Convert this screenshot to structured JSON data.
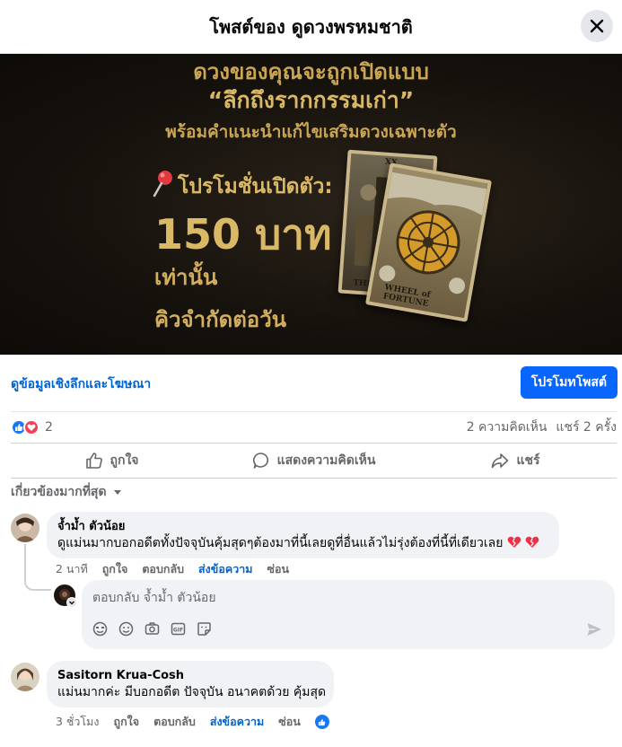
{
  "header": {
    "title": "โพสต์ของ ดูดวงพรหมชาติ"
  },
  "ad": {
    "line1": "ดวงของคุณจะถูกเปิดแบบ",
    "line2": "“ลึกถึงรากกรรมเก่า”",
    "line3": "พร้อมคำแนะนำแก้ไขเสริมดวงเฉพาะตัว",
    "line4": "โปรโมชั่นเปิดตัว:",
    "line5": "150 บาท",
    "line6": "เท่านั้น",
    "line7": "คิวจำกัดต่อวัน",
    "card_left_label": "THE",
    "card_right_label": "WHEEL of FORTUNE",
    "card_left_numeral": "XX"
  },
  "insights": {
    "link": "ดูข้อมูลเชิงลึกและโฆษณา",
    "promote_button": "โปรโมทโพสต์"
  },
  "reactions": {
    "count": "2",
    "comments": "2 ความคิดเห็น",
    "shares": "แชร์ 2 ครั้ง"
  },
  "actions": {
    "like": "ถูกใจ",
    "comment": "แสดงความคิดเห็น",
    "share": "แชร์"
  },
  "sort": {
    "label": "เกี่ยวข้องมากที่สุด"
  },
  "comments": [
    {
      "author": "จ้ำม้ำ ตัวน้อย",
      "text": "ดูแม่นมากบอกอดีตทั้งปัจจุบันคุ้มสุดๆต้องมาที่นี้เลยดูที่อื่นแล้วไม่รุ่งต้องที่นี้ที่เดียวเลย",
      "time": "2 นาที",
      "like": "ถูกใจ",
      "reply": "ตอบกลับ",
      "message": "ส่งข้อความ",
      "hide": "ซ่อน"
    },
    {
      "author": "Sasitorn Krua-Cosh",
      "text": "แม่นมากค่ะ มีบอกอดีต ปัจจุบัน อนาคตด้วย คุ้มสุด",
      "time": "3 ชั่วโมง",
      "like": "ถูกใจ",
      "reply": "ตอบกลับ",
      "message": "ส่งข้อความ",
      "hide": "ซ่อน"
    }
  ],
  "reply": {
    "placeholder": "ตอบกลับ จ้ำม้ำ ตัวน้อย"
  },
  "colors": {
    "accent": "#0866ff",
    "link": "#0064d1",
    "like": "#1877f2",
    "love": "#f33e58",
    "ad_gold": "#d9b866"
  }
}
